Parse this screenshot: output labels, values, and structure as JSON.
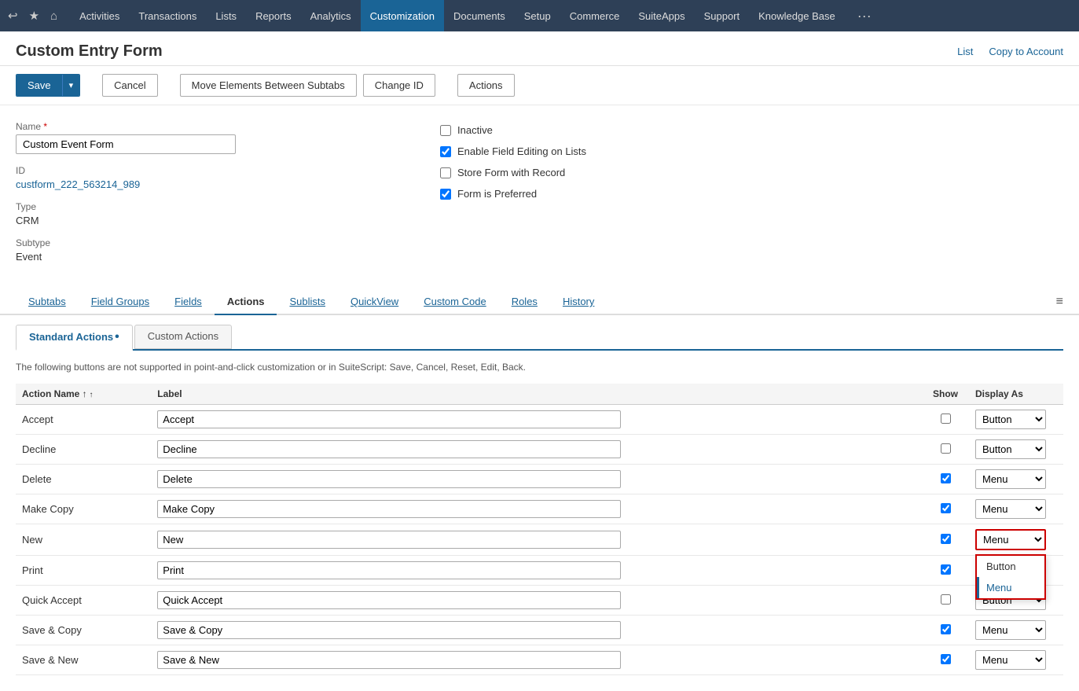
{
  "nav": {
    "icons": [
      "↩",
      "★",
      "⌂"
    ],
    "items": [
      "Activities",
      "Transactions",
      "Lists",
      "Reports",
      "Analytics",
      "Customization",
      "Documents",
      "Setup",
      "Commerce",
      "SuiteApps",
      "Support",
      "Knowledge Base",
      "···"
    ],
    "active": "Customization"
  },
  "pageHeader": {
    "title": "Custom Entry Form",
    "links": [
      "List",
      "Copy to Account"
    ]
  },
  "toolbar": {
    "saveLabel": "Save",
    "saveArrow": "▾",
    "cancelLabel": "Cancel",
    "moveElementsLabel": "Move Elements Between Subtabs",
    "changeIdLabel": "Change ID",
    "actionsLabel": "Actions"
  },
  "formFields": {
    "nameLabel": "Name",
    "nameRequired": true,
    "nameValue": "Custom Event Form",
    "idLabel": "ID",
    "idValue": "custform_222_563214_989",
    "typeLabel": "Type",
    "typeValue": "CRM",
    "subtypeLabel": "Subtype",
    "subtypeValue": "Event"
  },
  "checkboxes": [
    {
      "id": "cb-inactive",
      "label": "Inactive",
      "checked": false
    },
    {
      "id": "cb-fieldedit",
      "label": "Enable Field Editing on Lists",
      "checked": true
    },
    {
      "id": "cb-storeform",
      "label": "Store Form with Record",
      "checked": false
    },
    {
      "id": "cb-preferred",
      "label": "Form is Preferred",
      "checked": true
    }
  ],
  "tabs": {
    "items": [
      "Subtabs",
      "Field Groups",
      "Fields",
      "Actions",
      "Sublists",
      "QuickView",
      "Custom Code",
      "Roles",
      "History"
    ],
    "active": "Actions"
  },
  "subTabs": {
    "items": [
      "Standard Actions",
      "Custom Actions"
    ],
    "active": "Standard Actions",
    "activeDot": true
  },
  "noticeText": "The following buttons are not supported in point-and-click customization or in SuiteScript: Save, Cancel, Reset, Edit, Back.",
  "tableHeaders": {
    "actionName": "Action Name",
    "label": "Label",
    "show": "Show",
    "displayAs": "Display As"
  },
  "tableRows": [
    {
      "actionName": "Accept",
      "label": "Accept",
      "show": false,
      "displayAs": "Button"
    },
    {
      "actionName": "Decline",
      "label": "Decline",
      "show": false,
      "displayAs": "Button"
    },
    {
      "actionName": "Delete",
      "label": "Delete",
      "show": true,
      "displayAs": "Menu"
    },
    {
      "actionName": "Make Copy",
      "label": "Make Copy",
      "show": true,
      "displayAs": "Menu"
    },
    {
      "actionName": "New",
      "label": "New",
      "show": true,
      "displayAs": "Menu",
      "dropdownOpen": true
    },
    {
      "actionName": "Print",
      "label": "Print",
      "show": true,
      "displayAs": "Menu"
    },
    {
      "actionName": "Quick Accept",
      "label": "Quick Accept",
      "show": false,
      "displayAs": "Button"
    },
    {
      "actionName": "Save & Copy",
      "label": "Save & Copy",
      "show": true,
      "displayAs": "Menu"
    },
    {
      "actionName": "Save & New",
      "label": "Save & New",
      "show": true,
      "displayAs": "Menu"
    }
  ],
  "dropdownOptions": [
    "Button",
    "Menu"
  ],
  "displayOptions": [
    "Button",
    "Menu"
  ]
}
